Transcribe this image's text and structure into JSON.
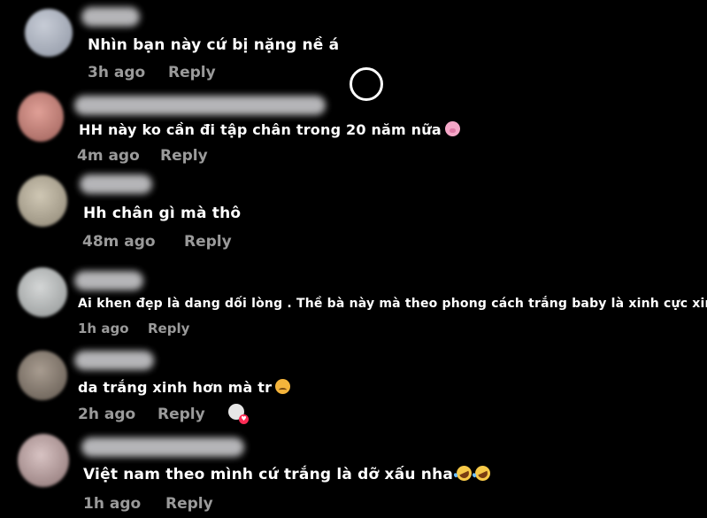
{
  "comments": [
    {
      "text": "Nhìn bạn này cứ bị nặng nề á",
      "emojis": [],
      "time": "3h ago",
      "reply_label": "Reply",
      "avatar_color": "#a9b0bd"
    },
    {
      "text": "HH này ko cần đi tập chân trong 20 năm nữa",
      "emojis": [
        "pig-nose-emoji"
      ],
      "time": "4m ago",
      "reply_label": "Reply",
      "avatar_color": "#d08a80"
    },
    {
      "text": "Hh chân gì mà thô",
      "emojis": [],
      "time": "48m ago",
      "reply_label": "Reply",
      "avatar_color": "#b7ae9c"
    },
    {
      "text": "Ai khen đẹp là dang dối lòng . Thề bà này mà theo phong cách trắng baby là xinh cực xinh .",
      "emojis": [],
      "time": "1h ago",
      "reply_label": "Reply",
      "avatar_color": "#bfc2c2"
    },
    {
      "text": "da trắng xinh hơn mà tr",
      "emojis": [
        "disappointed-face-emoji"
      ],
      "time": "2h ago",
      "reply_label": "Reply",
      "avatar_color": "#8f8378",
      "creator_liked": true
    },
    {
      "text": "Việt nam theo mình cứ trắng là dỡ xấu nha",
      "emojis": [
        "rofl-emoji",
        "rofl-emoji"
      ],
      "time": "1h ago",
      "reply_label": "Reply",
      "avatar_color": "#b9a6a6"
    }
  ],
  "colors": {
    "background": "#000000",
    "text": "#ffffff",
    "meta": "#9a9a9a",
    "like_heart": "#fe2c55"
  },
  "icons": {
    "cursor": "cursor-ring-icon",
    "liked_by_creator": "liked-by-creator-icon"
  }
}
